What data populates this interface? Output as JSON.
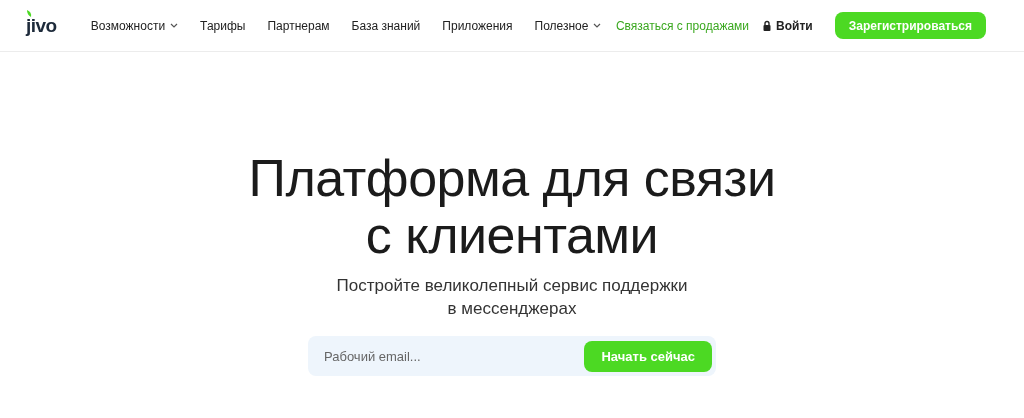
{
  "logo": {
    "text": "jivo"
  },
  "nav": [
    {
      "label": "Возможности",
      "has_menu": true
    },
    {
      "label": "Тарифы",
      "has_menu": false
    },
    {
      "label": "Партнерам",
      "has_menu": false
    },
    {
      "label": "База знаний",
      "has_menu": false
    },
    {
      "label": "Приложения",
      "has_menu": false
    },
    {
      "label": "Полезное",
      "has_menu": true
    }
  ],
  "contact_sales": "Связаться с продажами",
  "login": "Войти",
  "signup": "Зарегистрироваться",
  "hero": {
    "title": [
      "Платформа для связи",
      "с клиентами"
    ],
    "subtitle": [
      "Постройте великолепный сервис поддержки",
      "в мессенджерах"
    ],
    "email": {
      "placeholder": "Рабочий email..."
    },
    "cta": "Начать сейчас"
  }
}
